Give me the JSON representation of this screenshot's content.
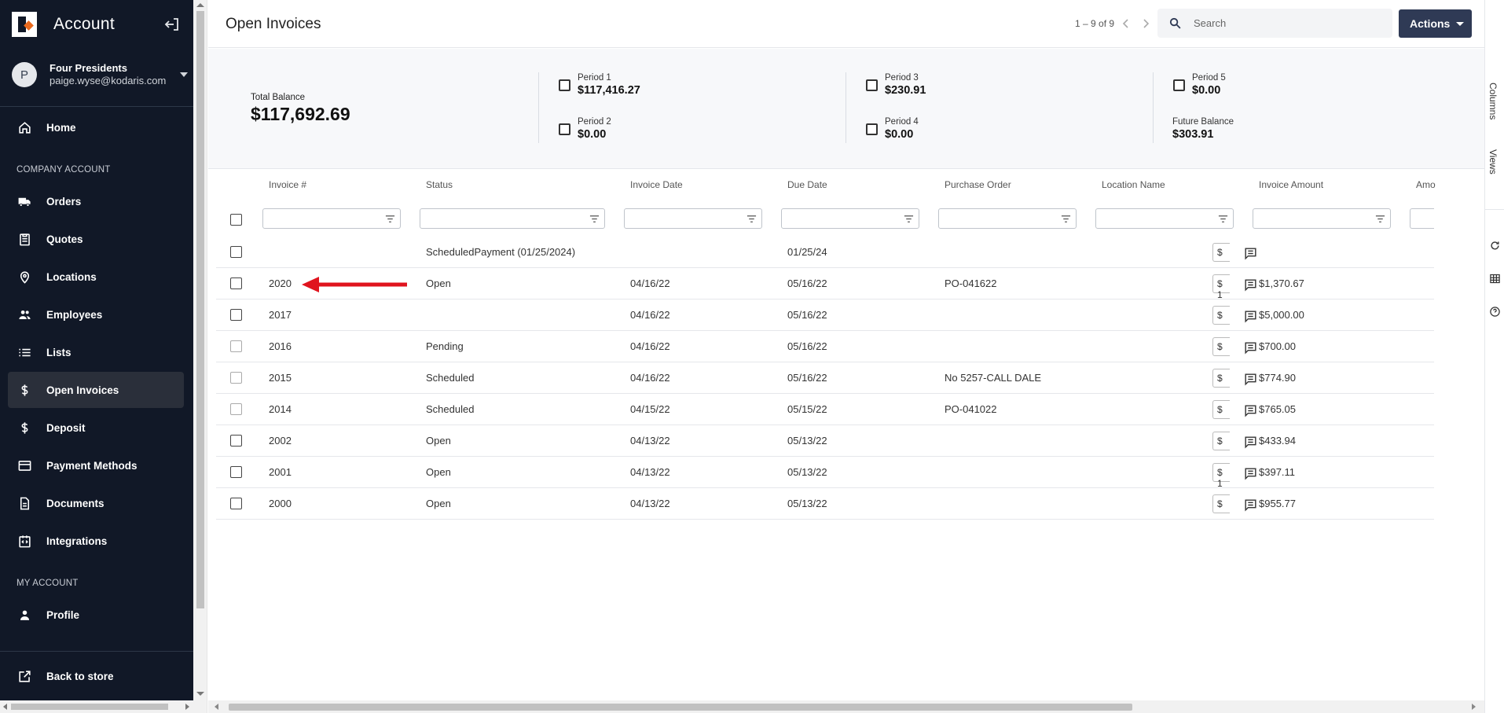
{
  "sidebar": {
    "title": "Account",
    "user": {
      "initial": "P",
      "name": "Four Presidents",
      "email": "paige.wyse@kodaris.com"
    },
    "sections": {
      "company": "COMPANY ACCOUNT",
      "my": "MY ACCOUNT"
    },
    "items": [
      {
        "label": "Home",
        "icon": "home-icon"
      },
      {
        "label": "Orders",
        "icon": "truck-icon"
      },
      {
        "label": "Quotes",
        "icon": "clipboard-icon"
      },
      {
        "label": "Locations",
        "icon": "location-pin-icon"
      },
      {
        "label": "Employees",
        "icon": "people-icon"
      },
      {
        "label": "Lists",
        "icon": "list-icon"
      },
      {
        "label": "Open Invoices",
        "icon": "dollar-icon",
        "active": true
      },
      {
        "label": "Deposit",
        "icon": "dollar-icon"
      },
      {
        "label": "Payment Methods",
        "icon": "credit-card-icon"
      },
      {
        "label": "Documents",
        "icon": "document-icon"
      },
      {
        "label": "Integrations",
        "icon": "integration-icon"
      },
      {
        "label": "Profile",
        "icon": "person-icon"
      },
      {
        "label": "Back to store",
        "icon": "external-link-icon"
      }
    ]
  },
  "header": {
    "title": "Open Invoices",
    "pager": "1 – 9 of 9",
    "search_placeholder": "Search",
    "actions_label": "Actions"
  },
  "summary": {
    "total_label": "Total Balance",
    "total_value": "$117,692.69",
    "periods": [
      {
        "label": "Period 1",
        "value": "$117,416.27"
      },
      {
        "label": "Period 2",
        "value": "$0.00"
      },
      {
        "label": "Period 3",
        "value": "$230.91"
      },
      {
        "label": "Period 4",
        "value": "$0.00"
      },
      {
        "label": "Period 5",
        "value": "$0.00"
      }
    ],
    "future_label": "Future Balance",
    "future_value": "$303.91"
  },
  "table": {
    "columns": [
      "Invoice #",
      "Status",
      "Invoice Date",
      "Due Date",
      "Purchase Order",
      "Location Name",
      "Invoice Amount",
      "Amo"
    ],
    "rows": [
      {
        "invoice": "",
        "status": "ScheduledPayment (01/25/2024)",
        "invoice_date": "",
        "due_date": "01/25/24",
        "po": "",
        "location": "",
        "amount": "",
        "pay": "$"
      },
      {
        "invoice": "2020",
        "status": "Open",
        "invoice_date": "04/16/22",
        "due_date": "05/16/22",
        "po": "PO-041622",
        "location": "",
        "amount": "$1,370.67",
        "pay": "$ 1"
      },
      {
        "invoice": "2017",
        "status": "",
        "invoice_date": "04/16/22",
        "due_date": "05/16/22",
        "po": "",
        "location": "",
        "amount": "$5,000.00",
        "pay": "$"
      },
      {
        "invoice": "2016",
        "status": "Pending",
        "invoice_date": "04/16/22",
        "due_date": "05/16/22",
        "po": "",
        "location": "",
        "amount": "$700.00",
        "pay": "$"
      },
      {
        "invoice": "2015",
        "status": "Scheduled",
        "invoice_date": "04/16/22",
        "due_date": "05/16/22",
        "po": "No 5257-CALL DALE",
        "location": "",
        "amount": "$774.90",
        "pay": "$"
      },
      {
        "invoice": "2014",
        "status": "Scheduled",
        "invoice_date": "04/15/22",
        "due_date": "05/15/22",
        "po": "PO-041022",
        "location": "",
        "amount": "$765.05",
        "pay": "$"
      },
      {
        "invoice": "2002",
        "status": "Open",
        "invoice_date": "04/13/22",
        "due_date": "05/13/22",
        "po": "",
        "location": "",
        "amount": "$433.94",
        "pay": "$"
      },
      {
        "invoice": "2001",
        "status": "Open",
        "invoice_date": "04/13/22",
        "due_date": "05/13/22",
        "po": "",
        "location": "",
        "amount": "$397.11",
        "pay": "$ 1"
      },
      {
        "invoice": "2000",
        "status": "Open",
        "invoice_date": "04/13/22",
        "due_date": "05/13/22",
        "po": "",
        "location": "",
        "amount": "$955.77",
        "pay": "$"
      }
    ]
  },
  "right_rail": {
    "columns_label": "Columns",
    "views_label": "Views"
  },
  "colors": {
    "sidebar_bg": "#111827",
    "accent": "#2f3a55",
    "brand_orange": "#ea6a1e",
    "annotation_red": "#e0141e"
  }
}
